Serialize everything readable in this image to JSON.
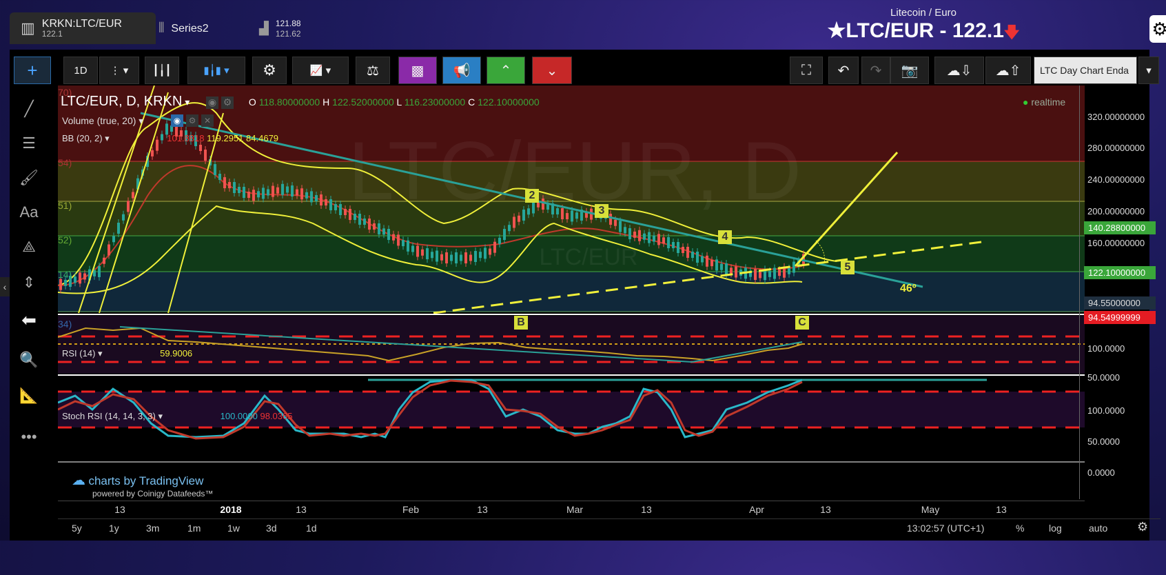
{
  "tabs": [
    {
      "label": "KRKN:LTC/EUR",
      "sub": "122.1"
    },
    {
      "label": "Series2",
      "sub": ""
    },
    {
      "label": "121.88",
      "sub": "121.62"
    }
  ],
  "header": {
    "pair_name": "Litecoin / Euro",
    "title": "LTC/EUR - 122.1"
  },
  "toolbar": {
    "interval": "1D",
    "layout_name": "LTC Day Chart Enda"
  },
  "legend": {
    "symbol": "LTC/EUR, D, KRKN",
    "o_label": "O",
    "o": "118.80000000",
    "h_label": "H",
    "h": "122.52000000",
    "l_label": "L",
    "l": "116.23000000",
    "c_label": "C",
    "c": "122.10000000",
    "volume": "Volume (true, 20)",
    "bb": "BB (20, 2)",
    "bb_mid": "101.8818",
    "bb_up": "119.2951",
    "bb_low": "84.4679",
    "realtime": "realtime",
    "watermark": "LTC/EUR, D",
    "watermark2": "LTC/EUR"
  },
  "fib_labels": [
    "70)",
    "54)",
    "51)",
    "52)",
    "14)",
    "34)"
  ],
  "price_axis": [
    "320.00000000",
    "280.00000000",
    "240.00000000",
    "200.00000000",
    "160.00000000"
  ],
  "price_boxes": {
    "a": "140.28800000",
    "b": "122.10000000",
    "c": "94.55000000",
    "d": "94.54999999"
  },
  "waves": [
    "2",
    "3",
    "4",
    "5",
    "B",
    "C"
  ],
  "angle": "46º",
  "rsi": {
    "label": "RSI (14)",
    "value": "59.9006",
    "axis": [
      "100.0000",
      "50.0000"
    ]
  },
  "stoch": {
    "label": "Stoch RSI (14, 14, 3, 3)",
    "k": "100.0000",
    "d": "98.0365",
    "axis": [
      "100.0000",
      "50.0000",
      "0.0000"
    ]
  },
  "branding": {
    "line1": "charts by TradingView",
    "line2": "powered by Coinigy Datafeeds™"
  },
  "x_axis": [
    "13",
    "2018",
    "13",
    "Feb",
    "13",
    "Mar",
    "13",
    "Apr",
    "13",
    "May",
    "13"
  ],
  "bottom": {
    "ranges": [
      "5y",
      "1y",
      "3m",
      "1m",
      "1w",
      "3d",
      "1d"
    ],
    "clock": "13:02:57 (UTC+1)",
    "pct": "%",
    "log": "log",
    "auto": "auto"
  },
  "colors": {
    "bullish": "#26a69a",
    "bearish": "#ef5350",
    "bollinger": "#f0f03a",
    "trend": "#2aa198",
    "positive_box": "#3aa63a",
    "negative_box": "#e51c23"
  }
}
